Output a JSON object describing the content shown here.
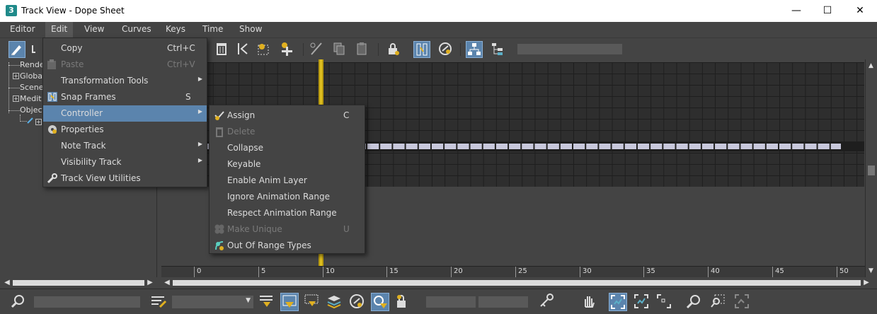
{
  "window": {
    "app_icon_text": "3",
    "title": "Track View - Dope Sheet",
    "minimize": "—",
    "maximize": "☐",
    "close": "✕"
  },
  "menubar": {
    "items": [
      {
        "label": "Editor"
      },
      {
        "label": "Edit",
        "active": true
      },
      {
        "label": "View"
      },
      {
        "label": "Curves"
      },
      {
        "label": "Keys"
      },
      {
        "label": "Time"
      },
      {
        "label": "Show"
      }
    ]
  },
  "edit_menu": {
    "items": [
      {
        "label": "Copy",
        "shortcut": "Ctrl+C",
        "enabled": true
      },
      {
        "label": "Paste",
        "shortcut": "Ctrl+V",
        "enabled": false,
        "icon": "paste-icon"
      },
      {
        "label": "Transformation Tools",
        "has_submenu": true,
        "enabled": true
      },
      {
        "label": "Snap Frames",
        "shortcut": "S",
        "enabled": true,
        "icon": "snap-frames-icon"
      },
      {
        "label": "Controller",
        "has_submenu": true,
        "enabled": true,
        "highlighted": true
      },
      {
        "label": "Properties",
        "enabled": true,
        "icon": "properties-icon"
      },
      {
        "label": "Note Track",
        "has_submenu": true,
        "enabled": true
      },
      {
        "label": "Visibility Track",
        "has_submenu": true,
        "enabled": true
      },
      {
        "label": "Track View Utilities",
        "enabled": true,
        "icon": "wrench-icon"
      }
    ]
  },
  "controller_submenu": {
    "items": [
      {
        "label": "Assign",
        "shortcut": "C",
        "enabled": true,
        "icon": "assign-icon"
      },
      {
        "label": "Delete",
        "enabled": false,
        "icon": "delete-icon"
      },
      {
        "label": "Collapse",
        "enabled": true
      },
      {
        "label": "Keyable",
        "enabled": true
      },
      {
        "label": "Enable Anim Layer",
        "enabled": true
      },
      {
        "label": "Ignore Animation Range",
        "enabled": true
      },
      {
        "label": "Respect Animation Range",
        "enabled": true
      },
      {
        "label": "Make Unique",
        "shortcut": "U",
        "enabled": false,
        "icon": "make-unique-icon"
      },
      {
        "label": "Out Of Range Types",
        "enabled": true,
        "icon": "out-of-range-icon"
      }
    ]
  },
  "tree": {
    "items": [
      {
        "label": "Rende"
      },
      {
        "label": "Global"
      },
      {
        "label": "Scene"
      },
      {
        "label": "Medit"
      },
      {
        "label": "Object"
      }
    ]
  },
  "timeline": {
    "ticks": [
      "0",
      "5",
      "10",
      "15",
      "20",
      "25",
      "30",
      "35",
      "40",
      "45",
      "50"
    ],
    "current_frame": 10
  },
  "colors": {
    "accent": "#5b84ad",
    "time_cursor": "#e0c020",
    "grid_background": "#2e2e2e",
    "key_color": "#c8c8dc"
  }
}
